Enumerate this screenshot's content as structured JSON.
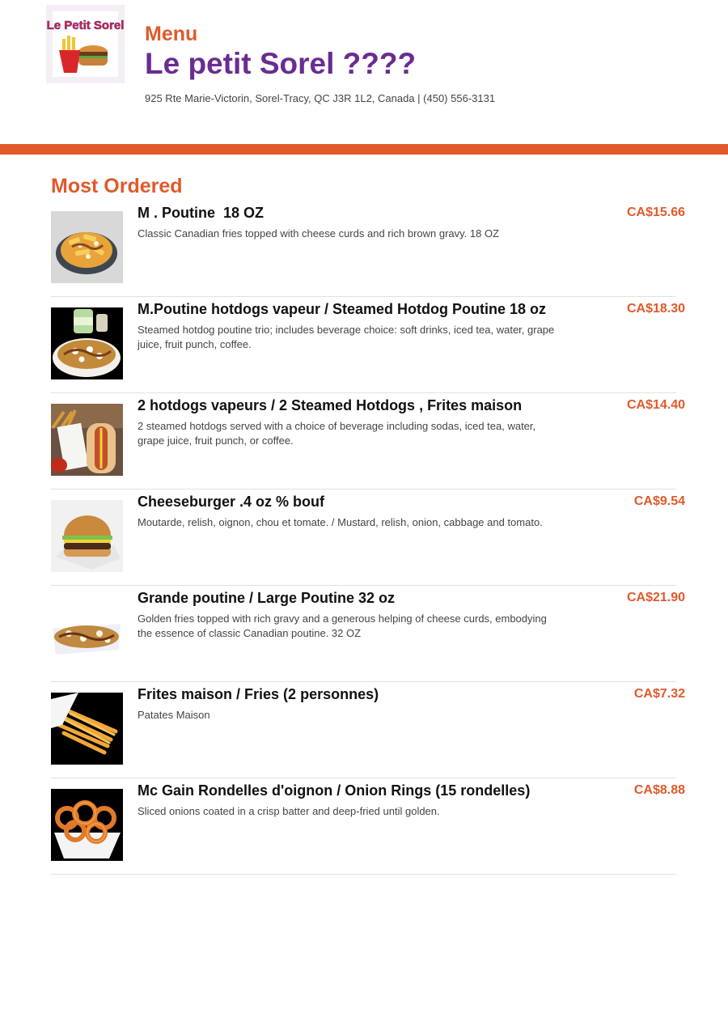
{
  "header": {
    "menu_label": "Menu",
    "restaurant_name": "Le petit Sorel ????",
    "address": "925 Rte Marie-Victorin, Sorel-Tracy, QC J3R 1L2, Canada | (450) 556-3131",
    "logo_text": "Le Petit Sorel"
  },
  "colors": {
    "accent": "#e05a2b",
    "brand": "#6a2c91"
  },
  "section": {
    "title": "Most Ordered"
  },
  "items": [
    {
      "name": "M . Poutine  18 OZ",
      "description": "Classic Canadian fries topped with cheese curds and rich brown gravy. 18 OZ",
      "price": "CA$15.66",
      "image_icon": "poutine-photo"
    },
    {
      "name": "M.Poutine hotdogs vapeur / Steamed Hotdog Poutine 18 oz",
      "description": "Steamed hotdog poutine trio; includes beverage choice: soft drinks, iced tea, water, grape juice, fruit punch, coffee.",
      "price": "CA$18.30",
      "image_icon": "hotdog-poutine-photo"
    },
    {
      "name": "2 hotdogs vapeurs / 2 Steamed Hotdogs , Frites maison",
      "description": "2 steamed hotdogs served with a choice of beverage including sodas, iced tea, water, grape juice, fruit punch, or coffee.",
      "price": "CA$14.40",
      "image_icon": "hotdogs-fries-photo"
    },
    {
      "name": "Cheeseburger .4 oz % bouf",
      "description": "Moutarde, relish, oignon, chou et tomate. / Mustard, relish, onion, cabbage and tomato.",
      "price": "CA$9.54",
      "image_icon": "cheeseburger-photo"
    },
    {
      "name": "Grande poutine / Large Poutine 32 oz",
      "description": "Golden fries topped with rich gravy and a generous helping of cheese curds, embodying the essence of classic Canadian poutine. 32 OZ",
      "price": "CA$21.90",
      "image_icon": "large-poutine-photo"
    },
    {
      "name": "Frites maison / Fries (2 personnes)",
      "description": "Patates Maison",
      "price": "CA$7.32",
      "image_icon": "fries-photo"
    },
    {
      "name": "Mc Gain Rondelles d'oignon / Onion Rings (15 rondelles)",
      "description": "Sliced onions coated in a crisp batter and deep-fried until golden.",
      "price": "CA$8.88",
      "image_icon": "onion-rings-photo"
    }
  ]
}
